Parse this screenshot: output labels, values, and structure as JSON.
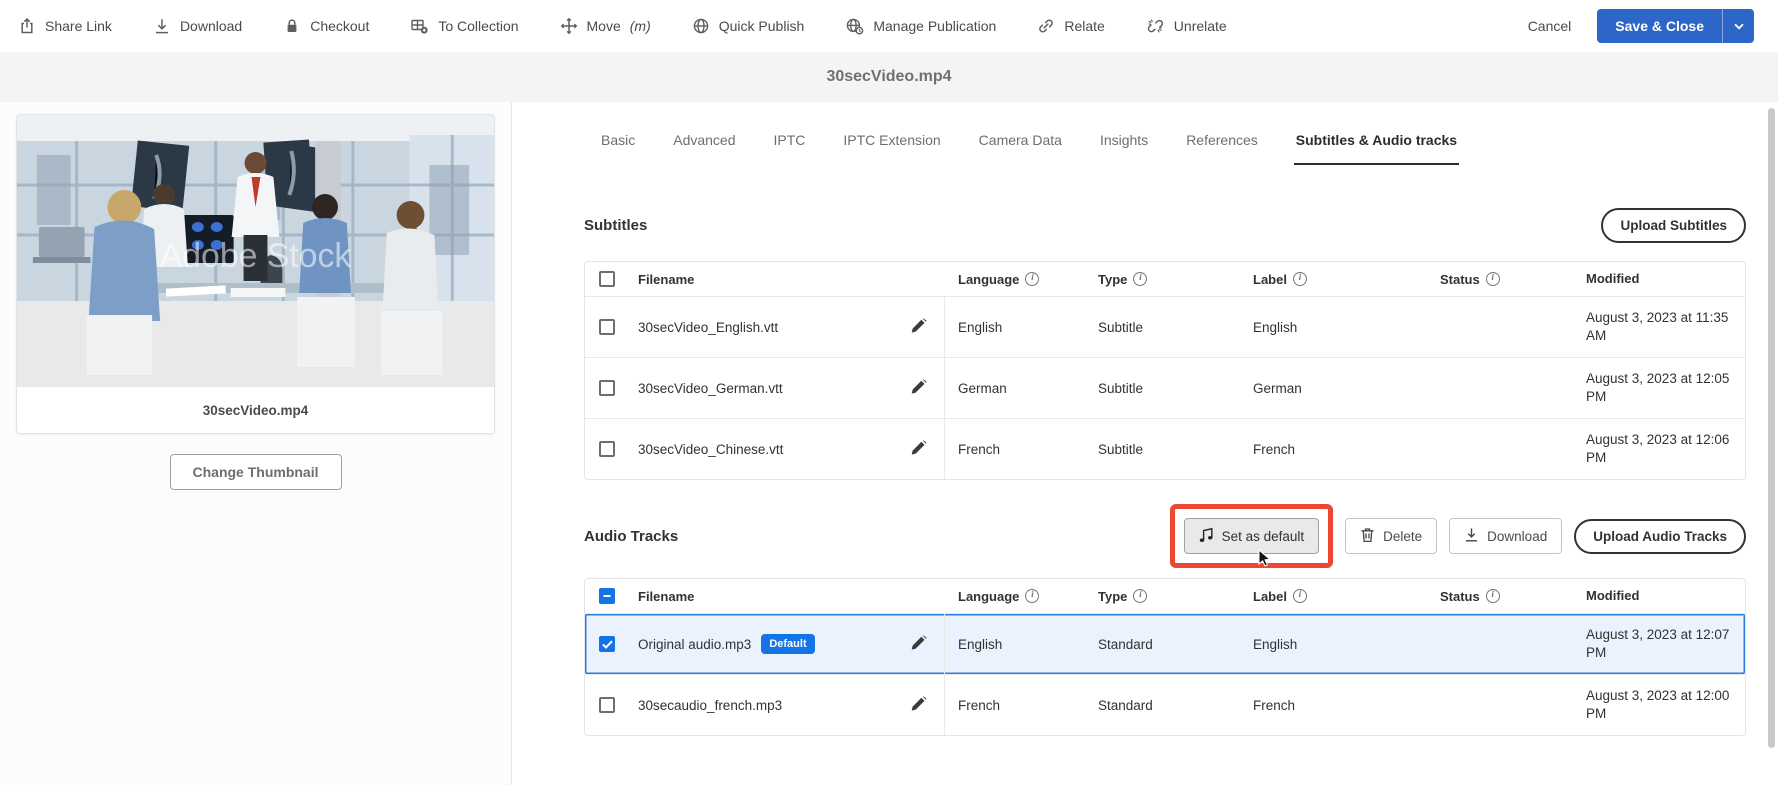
{
  "toolbar": {
    "items": [
      {
        "label": "Share Link",
        "icon": "share-icon"
      },
      {
        "label": "Download",
        "icon": "download-icon"
      },
      {
        "label": "Checkout",
        "icon": "lock-icon"
      },
      {
        "label": "To Collection",
        "icon": "collection-icon"
      },
      {
        "label": "Move",
        "shortcut": "(m)",
        "icon": "move-icon"
      },
      {
        "label": "Quick Publish",
        "icon": "globe-icon"
      },
      {
        "label": "Manage Publication",
        "icon": "globe-clock-icon"
      },
      {
        "label": "Relate",
        "icon": "link-icon"
      },
      {
        "label": "Unrelate",
        "icon": "unlink-icon"
      }
    ],
    "cancel_label": "Cancel",
    "save_label": "Save & Close"
  },
  "header": {
    "title": "30secVideo.mp4"
  },
  "preview": {
    "caption": "30secVideo.mp4",
    "watermark": "Adobe Stock",
    "change_thumbnail_label": "Change Thumbnail"
  },
  "tabs": [
    {
      "label": "Basic",
      "active": false
    },
    {
      "label": "Advanced",
      "active": false
    },
    {
      "label": "IPTC",
      "active": false
    },
    {
      "label": "IPTC Extension",
      "active": false
    },
    {
      "label": "Camera Data",
      "active": false
    },
    {
      "label": "Insights",
      "active": false
    },
    {
      "label": "References",
      "active": false
    },
    {
      "label": "Subtitles & Audio tracks",
      "active": true
    }
  ],
  "columns": [
    {
      "label": "Filename",
      "info": false
    },
    {
      "label": "Language",
      "info": true
    },
    {
      "label": "Type",
      "info": true
    },
    {
      "label": "Label",
      "info": true
    },
    {
      "label": "Status",
      "info": true
    },
    {
      "label": "Modified",
      "info": false
    }
  ],
  "subtitles": {
    "heading": "Subtitles",
    "upload_label": "Upload Subtitles",
    "rows": [
      {
        "filename": "30secVideo_English.vtt",
        "language": "English",
        "type": "Subtitle",
        "label": "English",
        "modified": "August 3, 2023 at 11:35 AM",
        "checked": false
      },
      {
        "filename": "30secVideo_German.vtt",
        "language": "German",
        "type": "Subtitle",
        "label": "German",
        "modified": "August 3, 2023 at 12:05\nPM",
        "checked": false
      },
      {
        "filename": "30secVideo_Chinese.vtt",
        "language": "French",
        "type": "Subtitle",
        "label": "French",
        "modified": "August 3, 2023 at 12:06\nPM",
        "checked": false
      }
    ]
  },
  "audio": {
    "heading": "Audio Tracks",
    "actions": {
      "set_default_label": "Set as default",
      "delete_label": "Delete",
      "download_label": "Download",
      "upload_label": "Upload Audio Tracks"
    },
    "header_checkbox_indeterminate": true,
    "rows": [
      {
        "filename": "Original audio.mp3",
        "badge": "Default",
        "language": "English",
        "type": "Standard",
        "label": "English",
        "modified": "August 3, 2023 at 12:07\nPM",
        "checked": true,
        "selected": true
      },
      {
        "filename": "30secaudio_french.mp3",
        "language": "French",
        "type": "Standard",
        "label": "French",
        "modified": "August 3, 2023 at 12:00\nPM",
        "checked": false,
        "selected": false
      }
    ]
  },
  "colors": {
    "accent_blue": "#1473e6",
    "save_button_blue": "#2c66c8",
    "selected_row_border": "#2a7de1",
    "selected_row_bg": "#e9f2fd",
    "annotation_red": "#ee4635"
  }
}
